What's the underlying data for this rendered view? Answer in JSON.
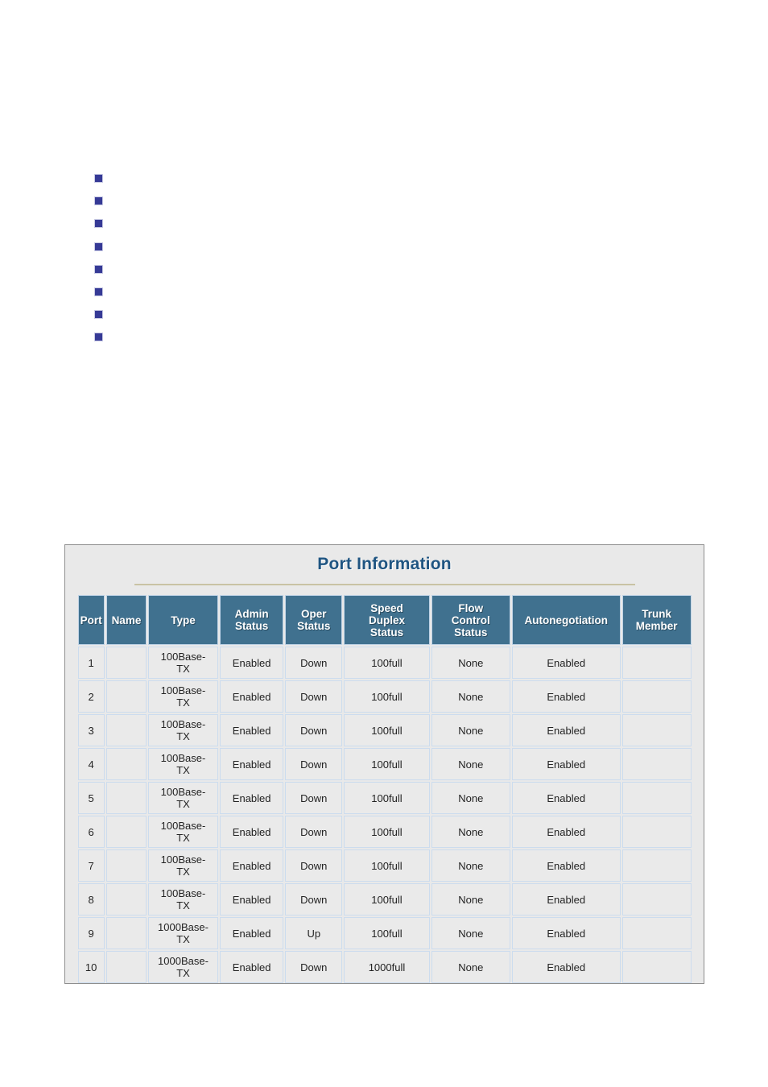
{
  "bullets": [
    {
      "marker": "square-bullet",
      "text": ""
    },
    {
      "marker": "square-bullet",
      "text": ""
    },
    {
      "marker": "square-bullet",
      "text": ""
    },
    {
      "marker": "square-bullet",
      "text": ""
    },
    {
      "marker": "square-bullet",
      "text": ""
    },
    {
      "marker": "square-bullet",
      "text": ""
    },
    {
      "marker": "square-bullet",
      "text": ""
    },
    {
      "marker": "square-bullet",
      "text": ""
    }
  ],
  "panel": {
    "title": "Port Information",
    "title_color": "#1f5582",
    "header_bg": "#40718f",
    "header_text_color": "#ffffff",
    "cell_bg": "#eaeaea",
    "panel_bg": "#e9e9e9",
    "rule_color": "#c9c3a4"
  },
  "table": {
    "columns": [
      "Port",
      "Name",
      "Type",
      "Admin Status",
      "Oper Status",
      "Speed Duplex Status",
      "Flow Control Status",
      "Autonegotiation",
      "Trunk Member"
    ],
    "column_labels": [
      [
        "Port"
      ],
      [
        "Name"
      ],
      [
        "Type"
      ],
      [
        "Admin",
        "Status"
      ],
      [
        "Oper",
        "Status"
      ],
      [
        "Speed",
        "Duplex",
        "Status"
      ],
      [
        "Flow",
        "Control",
        "Status"
      ],
      [
        "Autonegotiation"
      ],
      [
        "Trunk",
        "Member"
      ]
    ],
    "rows": [
      {
        "port": "1",
        "name": "",
        "type": "100Base-TX",
        "admin_status": "Enabled",
        "oper_status": "Down",
        "speed_duplex_status": "100full",
        "flow_control_status": "None",
        "autonegotiation": "Enabled",
        "trunk_member": ""
      },
      {
        "port": "2",
        "name": "",
        "type": "100Base-TX",
        "admin_status": "Enabled",
        "oper_status": "Down",
        "speed_duplex_status": "100full",
        "flow_control_status": "None",
        "autonegotiation": "Enabled",
        "trunk_member": ""
      },
      {
        "port": "3",
        "name": "",
        "type": "100Base-TX",
        "admin_status": "Enabled",
        "oper_status": "Down",
        "speed_duplex_status": "100full",
        "flow_control_status": "None",
        "autonegotiation": "Enabled",
        "trunk_member": ""
      },
      {
        "port": "4",
        "name": "",
        "type": "100Base-TX",
        "admin_status": "Enabled",
        "oper_status": "Down",
        "speed_duplex_status": "100full",
        "flow_control_status": "None",
        "autonegotiation": "Enabled",
        "trunk_member": ""
      },
      {
        "port": "5",
        "name": "",
        "type": "100Base-TX",
        "admin_status": "Enabled",
        "oper_status": "Down",
        "speed_duplex_status": "100full",
        "flow_control_status": "None",
        "autonegotiation": "Enabled",
        "trunk_member": ""
      },
      {
        "port": "6",
        "name": "",
        "type": "100Base-TX",
        "admin_status": "Enabled",
        "oper_status": "Down",
        "speed_duplex_status": "100full",
        "flow_control_status": "None",
        "autonegotiation": "Enabled",
        "trunk_member": ""
      },
      {
        "port": "7",
        "name": "",
        "type": "100Base-TX",
        "admin_status": "Enabled",
        "oper_status": "Down",
        "speed_duplex_status": "100full",
        "flow_control_status": "None",
        "autonegotiation": "Enabled",
        "trunk_member": ""
      },
      {
        "port": "8",
        "name": "",
        "type": "100Base-TX",
        "admin_status": "Enabled",
        "oper_status": "Down",
        "speed_duplex_status": "100full",
        "flow_control_status": "None",
        "autonegotiation": "Enabled",
        "trunk_member": ""
      },
      {
        "port": "9",
        "name": "",
        "type": "1000Base-TX",
        "admin_status": "Enabled",
        "oper_status": "Up",
        "speed_duplex_status": "100full",
        "flow_control_status": "None",
        "autonegotiation": "Enabled",
        "trunk_member": ""
      },
      {
        "port": "10",
        "name": "",
        "type": "1000Base-TX",
        "admin_status": "Enabled",
        "oper_status": "Down",
        "speed_duplex_status": "1000full",
        "flow_control_status": "None",
        "autonegotiation": "Enabled",
        "trunk_member": ""
      }
    ]
  }
}
